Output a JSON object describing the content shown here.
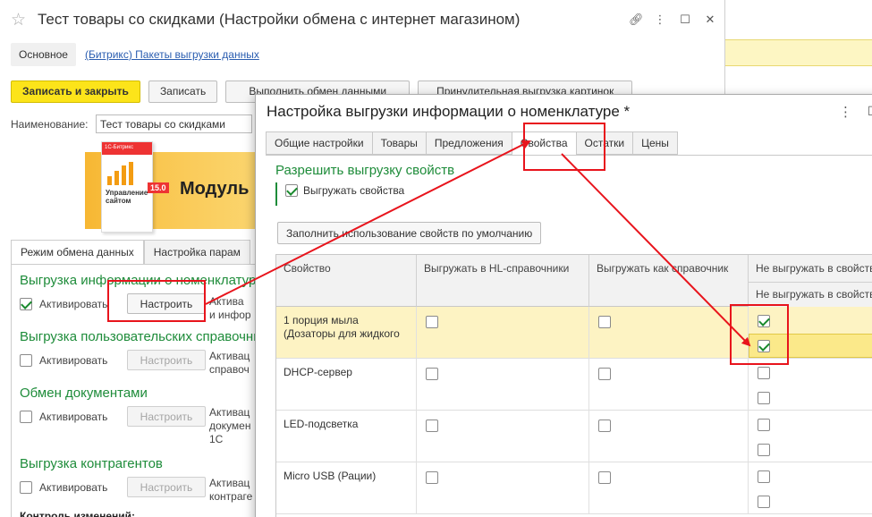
{
  "back_window": {
    "title": "Тест товары со скидками (Настройки обмена с интернет магазином)",
    "nav_main": "Основное",
    "nav_link": "(Битрикс) Пакеты выгрузки данных",
    "buttons": {
      "save_close": "Записать и закрыть",
      "save": "Записать",
      "run_exchange": "Выполнить обмен данными",
      "extra": "Принудительная выгрузка картинок"
    },
    "name_label": "Наименование:",
    "name_value": "Тест товары со скидками",
    "banner": {
      "text": "Модуль",
      "box_top": "1С-Битрикс",
      "box_text": "Управление сайтом",
      "badge": "15.0"
    },
    "tabs": [
      "Режим обмена данных",
      "Настройка парам"
    ],
    "sections": [
      {
        "title": "Выгрузка информации о номенклатуре",
        "checked": true,
        "activate": "Активировать",
        "button": "Настроить",
        "button_enabled": true,
        "desc": [
          "Актива",
          "и инфор"
        ]
      },
      {
        "title": "Выгрузка пользовательских справочников",
        "checked": false,
        "activate": "Активировать",
        "button": "Настроить",
        "button_enabled": false,
        "desc": [
          "Активац",
          "справоч"
        ]
      },
      {
        "title": "Обмен документами",
        "checked": false,
        "activate": "Активировать",
        "button": "Настроить",
        "button_enabled": false,
        "desc": [
          "Активац",
          "докумен",
          "1С"
        ]
      },
      {
        "title": "Выгрузка контрагентов",
        "checked": false,
        "activate": "Активировать",
        "button": "Настроить",
        "button_enabled": false,
        "desc": [
          "Активац",
          "контраге"
        ]
      }
    ],
    "bottom_cut": "Контроль изменений:"
  },
  "dialog": {
    "title": "Настройка выгрузки информации о номенклатуре *",
    "menu_icon": "⋮",
    "tabs": [
      {
        "label": "Общие настройки",
        "active": false
      },
      {
        "label": "Товары",
        "active": false
      },
      {
        "label": "Предложения",
        "active": false
      },
      {
        "label": "Свойства",
        "active": true
      },
      {
        "label": "Остатки",
        "active": false
      },
      {
        "label": "Цены",
        "active": false
      }
    ],
    "permission_title": "Разрешить выгрузку свойств",
    "permission_checkbox": "Выгружать свойства",
    "permission_checked": true,
    "fill_button": "Заполнить использование свойств по умолчанию",
    "grid": {
      "columns": [
        "Свойство",
        "Выгружать в HL-справочники",
        "Выгружать как справочник",
        "Не выгружать в свойства"
      ],
      "sub_column": "Не выгружать в свойства",
      "rows": [
        {
          "name": [
            "1 порция мыла",
            "(Дозаторы для жидкого"
          ],
          "hl": false,
          "dict": false,
          "no1": true,
          "no2": true,
          "selected": true
        },
        {
          "name": [
            "DHCP-сервер"
          ],
          "hl": false,
          "dict": false,
          "no1": false,
          "no2": false,
          "selected": false
        },
        {
          "name": [
            "LED-подсветка"
          ],
          "hl": false,
          "dict": false,
          "no1": false,
          "no2": false,
          "selected": false
        },
        {
          "name": [
            "Micro USB (Рации)"
          ],
          "hl": false,
          "dict": false,
          "no1": false,
          "no2": false,
          "selected": false
        }
      ]
    }
  },
  "colors": {
    "accent_yellow": "#fce41a",
    "section_green": "#1e8c3a",
    "annotation_red": "#e8141c",
    "selected_row": "#fdf3c3"
  }
}
